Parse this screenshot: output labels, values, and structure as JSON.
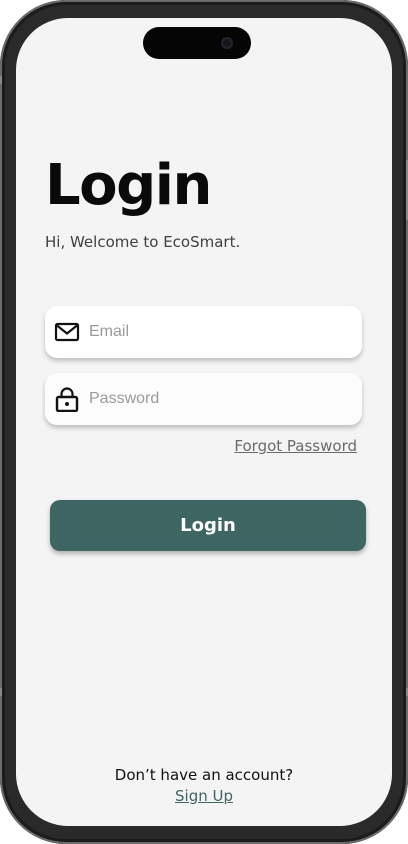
{
  "login": {
    "title": "Login",
    "subtitle": "Hi, Welcome to EcoSmart.",
    "email": {
      "placeholder": "Email",
      "icon": "mail-icon"
    },
    "password": {
      "placeholder": "Password",
      "icon": "lock-icon"
    },
    "forgot_password": "Forgot Password",
    "login_button": "Login",
    "no_account_text": "Don’t have an account?",
    "sign_up_link": "Sign Up"
  },
  "colors": {
    "primary": "#3d6663",
    "background": "#f4f4f4",
    "text": "#0a0a0a"
  }
}
